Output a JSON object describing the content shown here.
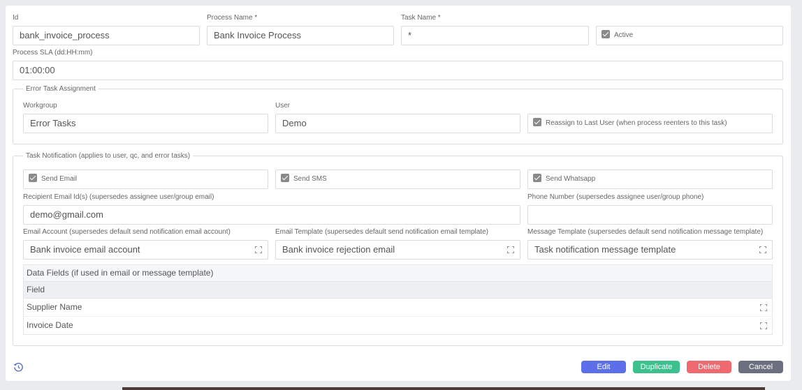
{
  "form": {
    "id": {
      "label": "Id",
      "value": "bank_invoice_process"
    },
    "process_name": {
      "label": "Process Name *",
      "value": "Bank Invoice Process"
    },
    "task_name": {
      "label": "Task Name *",
      "value": "*"
    },
    "active": {
      "label": "Active",
      "checked": true
    },
    "process_sla": {
      "label": "Process SLA (dd:HH:mm)",
      "value": "01:00:00"
    }
  },
  "error_task": {
    "legend": "Error Task Assignment",
    "workgroup": {
      "label": "Workgroup",
      "value": "Error Tasks"
    },
    "user": {
      "label": "User",
      "value": "Demo"
    },
    "reassign": {
      "label": "Reassign to Last User (when process reenters to this task)",
      "checked": true
    }
  },
  "notification": {
    "legend": "Task Notification (applies to user, qc, and error tasks)",
    "send_email": {
      "label": "Send Email",
      "checked": true
    },
    "send_sms": {
      "label": "Send SMS",
      "checked": true
    },
    "send_whatsapp": {
      "label": "Send Whatsapp",
      "checked": true
    },
    "recipient_email": {
      "label": "Recipient Email Id(s) (supersedes assignee user/group email)",
      "value": "demo@gmail.com"
    },
    "phone_number": {
      "label": "Phone Number (supersedes assignee user/group phone)",
      "value": ""
    },
    "email_account": {
      "label": "Email Account (supersedes default send notification email account)",
      "value": "Bank invoice email account"
    },
    "email_template": {
      "label": "Email Template (supersedes default send notification email template)",
      "value": "Bank invoice rejection email"
    },
    "message_template": {
      "label": "Message Template (supersedes default send notification message template)",
      "value": "Task notification message template"
    },
    "data_fields": {
      "title": "Data Fields (if used in email or message template)",
      "header": "Field",
      "rows": [
        "Supplier Name",
        "Invoice Date"
      ]
    }
  },
  "actions": {
    "edit": "Edit",
    "duplicate": "Duplicate",
    "delete": "Delete",
    "cancel": "Cancel"
  },
  "colors": {
    "edit": "#5c6ee8",
    "duplicate": "#3cc08e",
    "delete": "#ef6a70",
    "cancel": "#6c6f7f",
    "checkbox": "#8a8a8a"
  },
  "icons": {
    "expand": "expand-icon",
    "history": "history-icon"
  }
}
